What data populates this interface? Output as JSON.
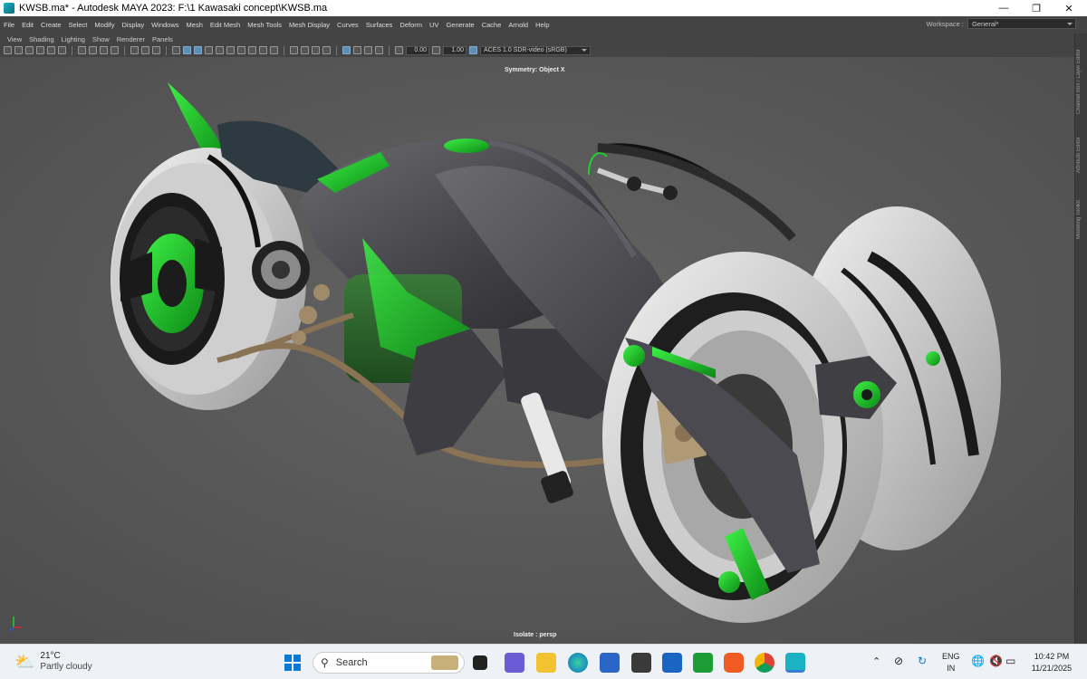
{
  "window": {
    "title": "KWSB.ma* - Autodesk MAYA 2023: F:\\1 Kawasaki concept\\KWSB.ma"
  },
  "menubar": {
    "items": [
      "File",
      "Edit",
      "Create",
      "Select",
      "Modify",
      "Display",
      "Windows",
      "Mesh",
      "Edit Mesh",
      "Mesh Tools",
      "Mesh Display",
      "Curves",
      "Surfaces",
      "Deform",
      "UV",
      "Generate",
      "Cache",
      "Arnold",
      "Help"
    ]
  },
  "workspace": {
    "label": "Workspace :",
    "value": "General*"
  },
  "viewport_menu": {
    "items": [
      "View",
      "Shading",
      "Lighting",
      "Show",
      "Renderer",
      "Panels"
    ]
  },
  "toolbar": {
    "field1": "0.00",
    "field2": "1.00",
    "colorspace": "ACES 1.0 SDR-video (sRGB)"
  },
  "viewport": {
    "symmetry": "Symmetry: Object X",
    "isolate": "Isolate : persp"
  },
  "side_tabs": [
    "Channel Box / Layer Editor",
    "Attribute Editor",
    "Modeling Toolkit"
  ],
  "taskbar": {
    "weather_temp": "21°C",
    "weather_cond": "Partly cloudy",
    "search_label": "Search",
    "lang_top": "ENG",
    "lang_bottom": "IN",
    "time": "10:42 PM",
    "date": "11/21/2025"
  },
  "colors": {
    "accent_green": "#1fd12a",
    "tire_white": "#d9d9d9",
    "body_gray": "#4a4a4e",
    "viewport_bg": "#585858"
  }
}
